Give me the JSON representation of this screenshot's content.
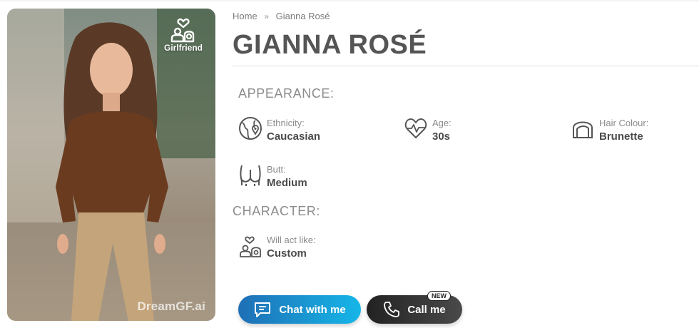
{
  "breadcrumb": {
    "home": "Home",
    "separator": "»",
    "current": "Gianna Rosé"
  },
  "title": "GIANNA ROSÉ",
  "photo": {
    "badge_label": "Girlfriend",
    "badge_icon": "couple-heart-icon",
    "watermark": "DreamGF.ai"
  },
  "appearance": {
    "title": "APPEARANCE:",
    "attributes": [
      {
        "icon": "globe-pin-icon",
        "label": "Ethnicity:",
        "value": "Caucasian"
      },
      {
        "icon": "heart-pulse-icon",
        "label": "Age:",
        "value": "30s"
      },
      {
        "icon": "hair-icon",
        "label": "Hair Colour:",
        "value": "Brunette"
      },
      {
        "icon": "butt-icon",
        "label": "Butt:",
        "value": "Medium"
      }
    ]
  },
  "character": {
    "title": "CHARACTER:",
    "attributes": [
      {
        "icon": "couple-heart-icon",
        "label": "Will act like:",
        "value": "Custom"
      }
    ]
  },
  "buttons": {
    "chat_label": "Chat with me",
    "call_label": "Call me",
    "call_badge": "NEW"
  },
  "colors": {
    "chat_gradient": [
      "#1f6fb5",
      "#16b6e8"
    ],
    "call_gradient": [
      "#222222",
      "#4a4a4a"
    ]
  }
}
